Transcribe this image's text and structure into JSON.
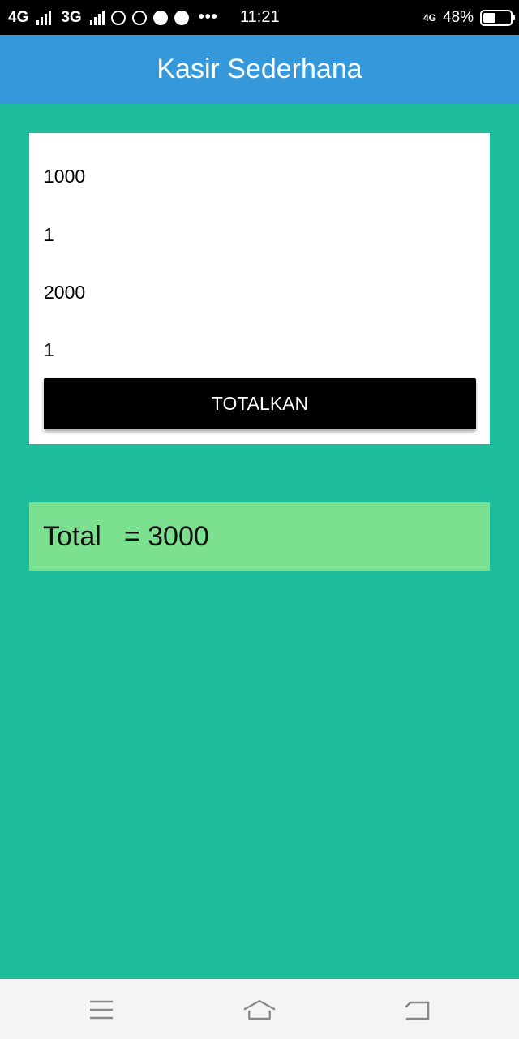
{
  "status_bar": {
    "network1": "4G",
    "network2": "3G",
    "time": "11:21",
    "data_type": "4G",
    "battery_percent": "48%",
    "battery_level": 0.48,
    "icons": [
      "hotspot-icon",
      "whatsapp-icon",
      "line-icon",
      "message-icon",
      "more-dots-icon"
    ]
  },
  "app_bar": {
    "title": "Kasir Sederhana"
  },
  "form": {
    "price1": "1000",
    "qty1": "1",
    "price2": "2000",
    "qty2": "1",
    "button_label": "TOTALKAN"
  },
  "result": {
    "label": "Total",
    "value": "= 3000"
  },
  "nav": {
    "icons": [
      "menu-icon",
      "home-icon",
      "back-icon"
    ]
  },
  "colors": {
    "app_bar": "#3498db",
    "background": "#1dbd9b",
    "result_bg": "#7be08f",
    "button": "#000000"
  }
}
